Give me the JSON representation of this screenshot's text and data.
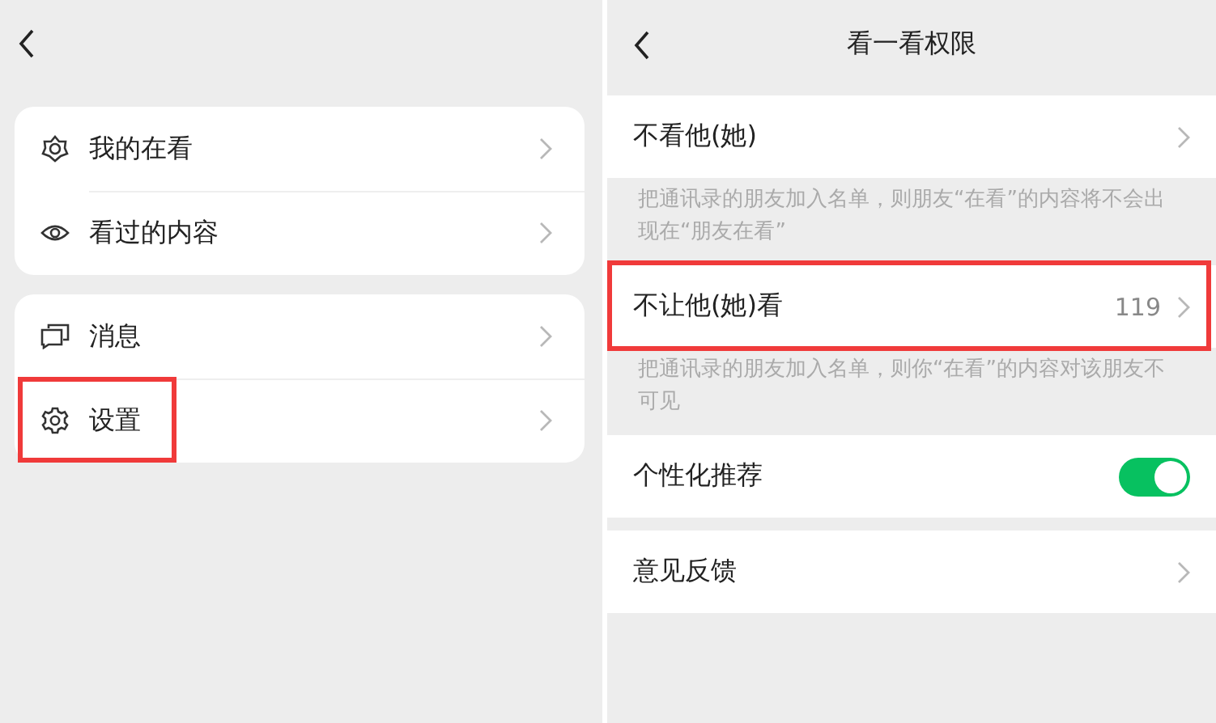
{
  "left": {
    "groups": [
      {
        "items": [
          {
            "label": "我的在看",
            "highlighted": false
          },
          {
            "label": "看过的内容",
            "highlighted": false
          }
        ]
      },
      {
        "items": [
          {
            "label": "消息",
            "highlighted": false
          },
          {
            "label": "设置",
            "highlighted": true
          }
        ]
      }
    ]
  },
  "right": {
    "title": "看一看权限",
    "sections": [
      {
        "kind": "link",
        "label": "不看他(她)",
        "highlighted": false,
        "hint": "把通讯录的朋友加入名单，则朋友“在看”的内容将不会出现在“朋友在看”"
      },
      {
        "kind": "link",
        "label": "不让他(她)看",
        "value": "119",
        "highlighted": true,
        "hint": "把通讯录的朋友加入名单，则你“在看”的内容对该朋友不可见"
      },
      {
        "kind": "toggle",
        "label": "个性化推荐",
        "on": true,
        "highlighted": false
      },
      {
        "kind": "link",
        "label": "意见反馈",
        "highlighted": false
      }
    ]
  }
}
